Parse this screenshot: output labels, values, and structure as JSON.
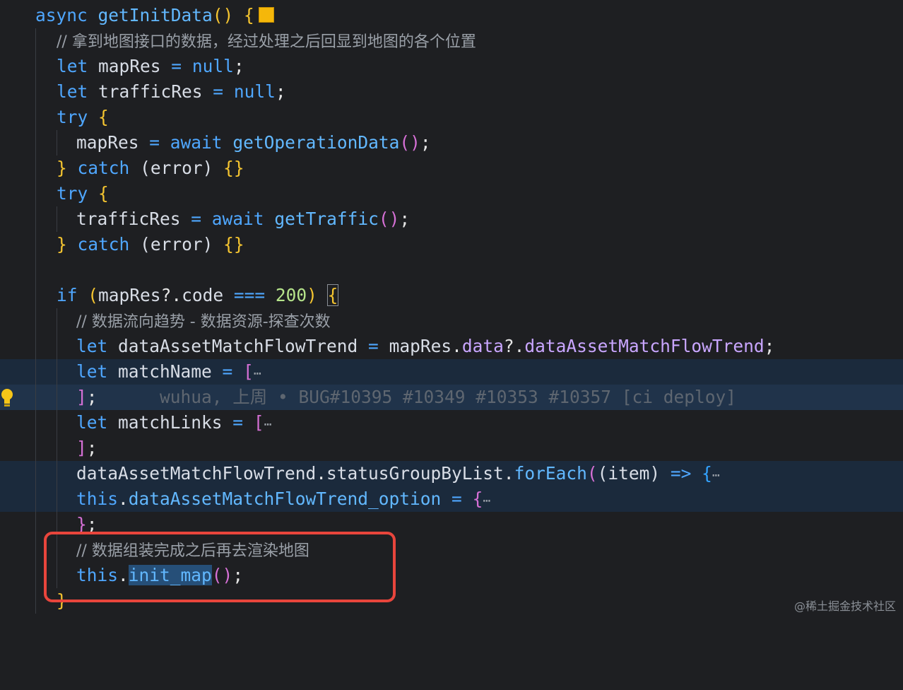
{
  "lines": {
    "l1": {
      "kw": "async",
      "fn": "getInitData",
      "punc": "() {"
    },
    "l2": {
      "comment": "// 拿到地图接口的数据，经过处理之后回显到地图的各个位置"
    },
    "l3": {
      "kw": "let",
      "var": "mapRes",
      "op": " = ",
      "val": "null",
      "end": ";"
    },
    "l4": {
      "kw": "let",
      "var": "trafficRes",
      "op": " = ",
      "val": "null",
      "end": ";"
    },
    "l5": {
      "kw": "try",
      "brace": "{"
    },
    "l6": {
      "var": "mapRes",
      "op": " = ",
      "kw": "await",
      "fn": "getOperationData",
      "call": "()",
      "end": ";"
    },
    "l7": {
      "close": "}",
      "kw": "catch",
      "args": "(error)",
      "block": "{}"
    },
    "l8": {
      "kw": "try",
      "brace": "{"
    },
    "l9": {
      "var": "trafficRes",
      "op": " = ",
      "kw": "await",
      "fn": "getTraffic",
      "call": "()",
      "end": ";"
    },
    "l10": {
      "close": "}",
      "kw": "catch",
      "args": "(error)",
      "block": "{}"
    },
    "l11": {
      "kw": "if",
      "open": "(",
      "var": "mapRes",
      "op1": "?.",
      "prop": "code",
      "op2": " === ",
      "num": "200",
      "close": ")",
      "brace": "{"
    },
    "l12": {
      "comment": "// 数据流向趋势 - 数据资源-探查次数"
    },
    "l13": {
      "kw": "let",
      "var": "dataAssetMatchFlowTrend",
      "op": " = ",
      "obj": "mapRes",
      "dot": ".",
      "prop": "data",
      "opt": "?.",
      "prop2": "dataAssetMatchFlowTrend",
      "end": ";"
    },
    "l14": {
      "kw": "let",
      "var": "matchName",
      "op": " = ",
      "bracket": "[",
      "ellipsis": "⋯"
    },
    "l15": {
      "bracket": "]",
      "end": ";",
      "blame": "wuhua, 上周 • BUG#10395 #10349 #10353 #10357 [ci deploy]"
    },
    "l16": {
      "kw": "let",
      "var": "matchLinks",
      "op": " = ",
      "bracket": "[",
      "ellipsis": "⋯"
    },
    "l17": {
      "bracket": "]",
      "end": ";"
    },
    "l18": {
      "obj": "dataAssetMatchFlowTrend",
      "dot1": ".",
      "prop": "statusGroupByList",
      "dot2": ".",
      "fn": "forEach",
      "open": "(",
      "args": "(item)",
      "arrow": " => ",
      "brace": "{",
      "ellipsis": "⋯"
    },
    "l19": {
      "kw": "this",
      "dot": ".",
      "prop": "dataAssetMatchFlowTrend_option",
      "op": " = ",
      "brace": "{",
      "ellipsis": "⋯"
    },
    "l20": {
      "brace": "}",
      "end": ";"
    },
    "l21": {
      "comment": "// 数据组装完成之后再去渲染地图"
    },
    "l22": {
      "kw": "this",
      "dot": ".",
      "fn": "init_map",
      "call": "()",
      "end": ";"
    },
    "l23": {
      "brace": "}"
    }
  },
  "watermark": "@稀土掘金技术社区",
  "colors": {
    "background": "#1e1f22",
    "keyword": "#4fa7ff",
    "highlight_box": "#e8453c",
    "string_yellow": "#f4c430"
  }
}
